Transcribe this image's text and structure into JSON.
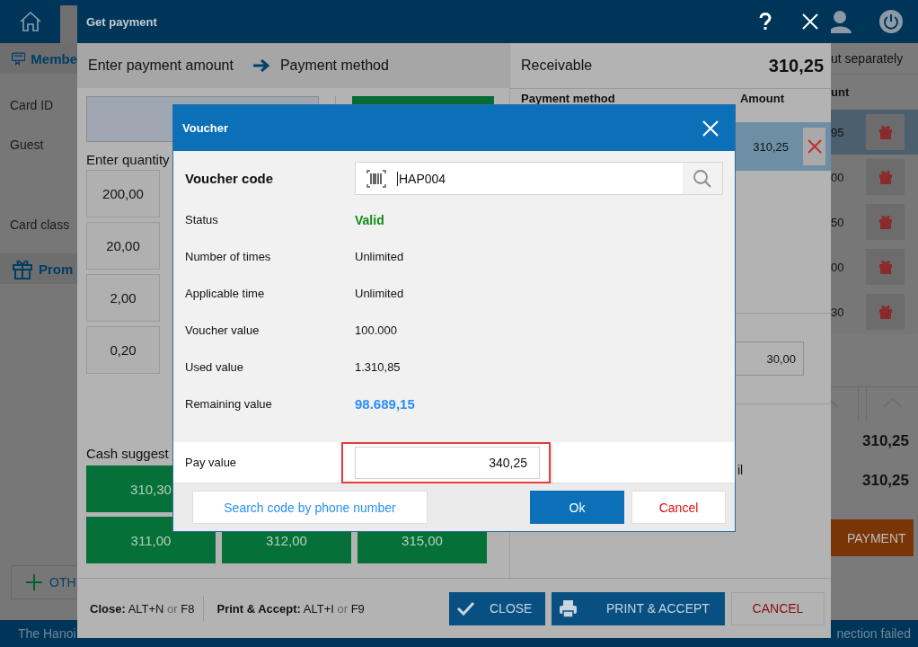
{
  "app": {
    "left_panel": {
      "member_heading": "Membe",
      "fields": [
        "Card ID",
        "Guest",
        "Card class"
      ],
      "promotion_heading": "Prom",
      "other_button": "OTH"
    },
    "right_panel": {
      "heading": "ut separately",
      "column": "unt",
      "rows": [
        {
          "amount": "95",
          "selected": true
        },
        {
          "amount": "00",
          "selected": false
        },
        {
          "amount": "50",
          "selected": false
        },
        {
          "amount": "00",
          "selected": false
        },
        {
          "amount": "30",
          "selected": false
        }
      ],
      "totals": [
        "310,25",
        "310,25"
      ],
      "payment_button": "PAYMENT"
    },
    "status_bar": {
      "left": "The Hanoi",
      "right": "nection failed"
    }
  },
  "payment_dialog": {
    "title": "Get payment",
    "steps": [
      "Enter payment amount",
      "Payment method"
    ],
    "quantity_label": "Enter quantity",
    "keypad": [
      "200,00",
      "20,00",
      "2,00",
      "0,20"
    ],
    "cash_label": "Cash suggest",
    "cash_suggestions": [
      "310,30",
      "311,00",
      "312,00",
      "315,00"
    ],
    "receivable": {
      "label": "Receivable",
      "value": "310,25"
    },
    "columns": [
      "Payment method",
      "Amount"
    ],
    "payment_rows": [
      {
        "amount": "310,25",
        "selected": true
      }
    ],
    "change_value": "30,00",
    "cut_label": "il",
    "shortcuts": [
      {
        "name": "Close:",
        "keys": "ALT+N",
        "or": "or",
        "alt": "F8"
      },
      {
        "name": "Print & Accept:",
        "keys": "ALT+I",
        "or": "or",
        "alt": "F9"
      }
    ],
    "buttons": [
      {
        "label": "CLOSE",
        "kind": "close"
      },
      {
        "label": "PRINT & ACCEPT",
        "kind": "print"
      },
      {
        "label": "CANCEL",
        "kind": "cancel"
      }
    ]
  },
  "voucher_dialog": {
    "title": "Voucher",
    "code": {
      "label": "Voucher code",
      "value": "HAP004"
    },
    "details": [
      {
        "label": "Status",
        "value": "Valid",
        "kind": "status"
      },
      {
        "label": "Number of times",
        "value": "Unlimited",
        "kind": "plain"
      },
      {
        "label": "Applicable time",
        "value": "Unlimited",
        "kind": "plain"
      },
      {
        "label": "Voucher value",
        "value": "100.000",
        "kind": "plain"
      },
      {
        "label": "Used value",
        "value": "1.310,85",
        "kind": "plain"
      },
      {
        "label": "Remaining value",
        "value": "98.689,15",
        "kind": "highlight"
      }
    ],
    "pay": {
      "label": "Pay value",
      "value": "340,25",
      "highlighted": true
    },
    "buttons": [
      {
        "label": "Search code by phone number",
        "kind": "link"
      },
      {
        "label": "Ok",
        "kind": "primary"
      },
      {
        "label": "Cancel",
        "kind": "cancel"
      }
    ]
  }
}
